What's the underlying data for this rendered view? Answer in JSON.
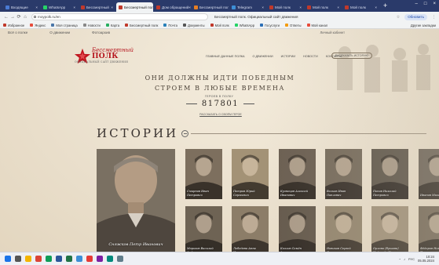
{
  "browser": {
    "tabs": [
      {
        "label": "Входящие",
        "color": "#4a7bd4",
        "active": false
      },
      {
        "label": "WhatsApp",
        "color": "#25d366",
        "active": false
      },
      {
        "label": "Бессмертный",
        "color": "#c0392b",
        "active": false
      },
      {
        "label": "Бессмертный полк",
        "color": "#c0392b",
        "active": true
      },
      {
        "label": "Дом обращений",
        "color": "#c0392b",
        "active": false
      },
      {
        "label": "Бессмертный полк",
        "color": "#e67e22",
        "active": false
      },
      {
        "label": "Telegram",
        "color": "#3d8fd6",
        "active": false
      },
      {
        "label": "Мой полк",
        "color": "#c0392b",
        "active": false
      },
      {
        "label": "Мой полк",
        "color": "#c0392b",
        "active": false
      },
      {
        "label": "Мой полк",
        "color": "#c0392b",
        "active": false
      }
    ],
    "tab_close": "×",
    "new_tab": "+",
    "window_controls": [
      "–",
      "□",
      "×"
    ],
    "nav": {
      "back": "←",
      "forward": "→",
      "reload": "⟳",
      "home": "⌂"
    },
    "url": "moypolk.ru/en",
    "page_title": "Бессмертный полк. Официальный сайт движения",
    "profile_label": "Обновить",
    "menu_icon": "⋮",
    "bookmarks": [
      {
        "label": "Избранное",
        "color": "#c0392b"
      },
      {
        "label": "Яндекс",
        "color": "#e74c3c"
      },
      {
        "label": "Моя страница",
        "color": "#4a76a8"
      },
      {
        "label": "Новости",
        "color": "#888"
      },
      {
        "label": "Карта",
        "color": "#27ae60"
      },
      {
        "label": "Бессмертный полк",
        "color": "#c0392b"
      },
      {
        "label": "Почта",
        "color": "#2980b9"
      },
      {
        "label": "Документы",
        "color": "#555"
      },
      {
        "label": "Мой полк",
        "color": "#c0392b"
      },
      {
        "label": "WhatsApp",
        "color": "#25d366"
      },
      {
        "label": "Госуслуги",
        "color": "#2c6fb7"
      },
      {
        "label": "Ответы",
        "color": "#f39c12"
      },
      {
        "label": "Мой канал",
        "color": "#e74c3c"
      }
    ],
    "bookmarks_folder": "Другие закладки"
  },
  "site": {
    "subbar_items": [
      "Всё о полке",
      "О движении",
      "Фотоархив"
    ],
    "subbar_right": "Личный кабинет",
    "logo": {
      "line1": "Бессмертный",
      "line2": "ПОЛК",
      "tagline": "ОФИЦИАЛЬНЫЙ САЙТ ДВИЖЕНИЯ"
    },
    "nav": [
      "ГЛАВНЫЕ ДАННЫЕ ПОЛКА",
      "О ДВИЖЕНИИ",
      "ИСТОРИИ",
      "НОВОСТИ",
      "КОНТАКТЫ"
    ],
    "nav_cta": "РАССКАЗАТЬ ИСТОРИЮ",
    "slogan_line1": "ОНИ ДОЛЖНЫ ИДТИ ПОБЕДНЫМ",
    "slogan_line2": "СТРОЕМ В ЛЮБЫЕ ВРЕМЕНА",
    "counter_caption": "ГЕРОЕВ В ПОЛКУ",
    "counter_value": "817801",
    "counter_link": "РАССКАЗАТЬ О СВОЁМ ГЕРОЕ",
    "stories_title": "ИСТОРИИ",
    "featured": {
      "name": "Сняжков Петр Иванович"
    },
    "cards_row1": [
      {
        "name": "Смирнов Иван Петрович",
        "photo": "#7d6f5e"
      },
      {
        "name": "Петров Юрий Сергеевич",
        "photo": "#a39276"
      },
      {
        "name": "Кузнецов Алексей Иванович",
        "photo": "#6b5f52"
      },
      {
        "name": "Волков Иван Павлович",
        "photo": "#756a5b"
      },
      {
        "name": "Попов Николай Петрович",
        "photo": "#5e564b"
      },
      {
        "name": "Иванов Михаил Ильич",
        "photo": "#6d6459"
      }
    ],
    "cards_row2": [
      {
        "name": "Морозов Василий Андреевич",
        "photo": "#6e6354"
      },
      {
        "name": "Лебедева Анна Ивановна",
        "photo": "#8c7d68"
      },
      {
        "name": "Козлов Семён Алексеевич",
        "photo": "#655a4d"
      },
      {
        "name": "Новиков Сергей Степанович",
        "photo": "#93856e"
      },
      {
        "name": "Орлова (Ершова) Надежда Ильинична",
        "photo": "#a0917a"
      },
      {
        "name": "Фёдоров Николай Петрович",
        "photo": "#766a5a"
      }
    ]
  },
  "taskbar": {
    "icons": [
      {
        "name": "start-icon",
        "color": "#1a73e8"
      },
      {
        "name": "search-icon",
        "color": "#555"
      },
      {
        "name": "explorer-icon",
        "color": "#f4b400"
      },
      {
        "name": "chrome-icon",
        "color": "#db4437"
      },
      {
        "name": "edge-icon",
        "color": "#0f9d58"
      },
      {
        "name": "word-icon",
        "color": "#2b579a"
      },
      {
        "name": "excel-icon",
        "color": "#217346"
      },
      {
        "name": "telegram-icon",
        "color": "#3d8fd6"
      },
      {
        "name": "yandex-icon",
        "color": "#e53935"
      },
      {
        "name": "mail-icon",
        "color": "#7b1fa2"
      },
      {
        "name": "photos-icon",
        "color": "#00897b"
      },
      {
        "name": "settings-icon",
        "color": "#607d8b"
      }
    ],
    "lang": "РУС",
    "time": "10:24",
    "date": "05.05.2024"
  }
}
